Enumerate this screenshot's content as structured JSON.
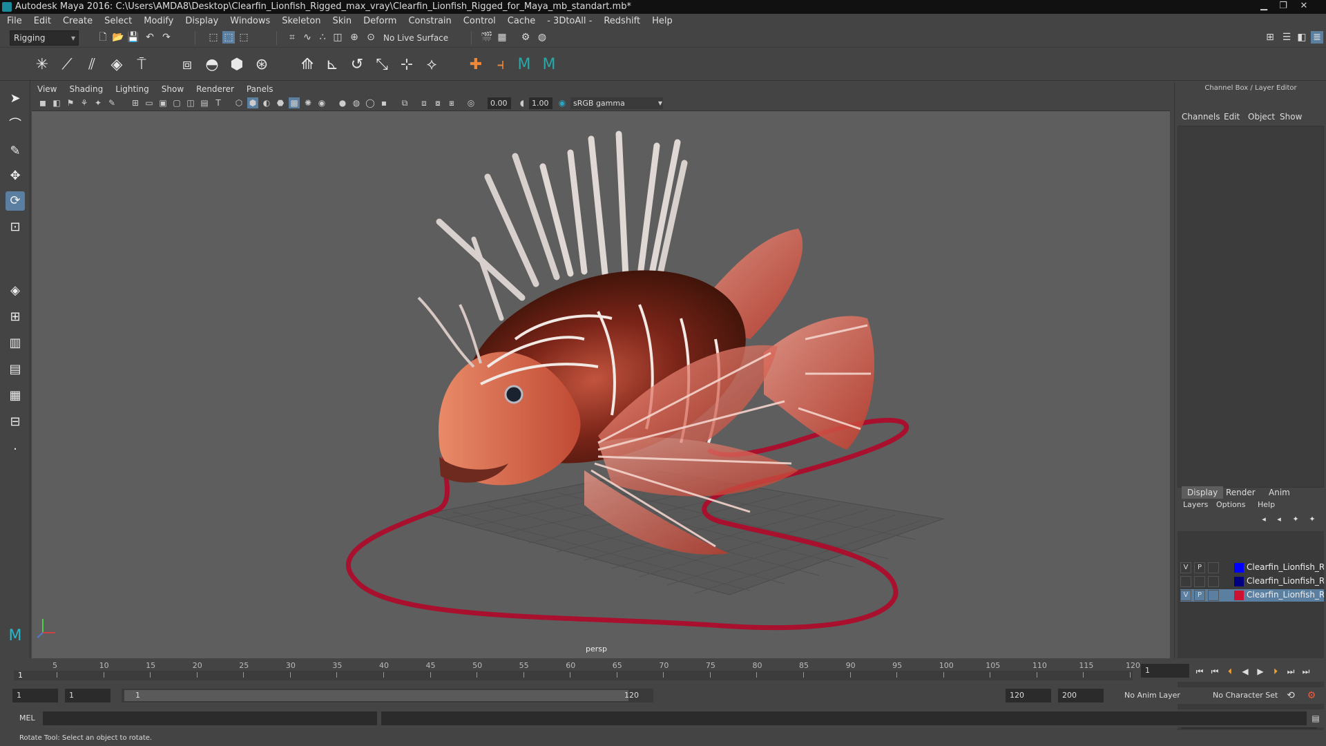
{
  "window": {
    "title": "Autodesk Maya 2016: C:\\Users\\AMDA8\\Desktop\\Clearfin_Lionfish_Rigged_max_vray\\Clearfin_Lionfish_Rigged_for_Maya_mb_standart.mb*"
  },
  "menu": [
    "File",
    "Edit",
    "Create",
    "Select",
    "Modify",
    "Display",
    "Windows",
    "Skeleton",
    "Skin",
    "Deform",
    "Constrain",
    "Control",
    "Cache",
    "- 3DtoAll -",
    "Redshift",
    "Help"
  ],
  "shelf": {
    "mode": "Rigging",
    "live_surface": "No Live Surface"
  },
  "viewport": {
    "menu": [
      "View",
      "Shading",
      "Lighting",
      "Show",
      "Renderer",
      "Panels"
    ],
    "exposure": "0.00",
    "gamma": "1.00",
    "color_space": "sRGB gamma",
    "camera_label": "persp"
  },
  "channel_box": {
    "title": "Channel Box / Layer Editor",
    "menu": [
      "Channels",
      "Edit",
      "Object",
      "Show"
    ]
  },
  "layer_editor": {
    "tabs": [
      "Display",
      "Render",
      "Anim"
    ],
    "menu": [
      "Layers",
      "Options",
      "Help"
    ],
    "layers": [
      {
        "v": "V",
        "p": "P",
        "color": "#0000ff",
        "name": "Clearfin_Lionfish_Rigg",
        "selected": false
      },
      {
        "v": "",
        "p": "",
        "color": "#000080",
        "name": "Clearfin_Lionfish_Rigg",
        "selected": false
      },
      {
        "v": "V",
        "p": "P",
        "color": "#cc1133",
        "name": "Clearfin_Lionfish_Rigg",
        "selected": true
      }
    ]
  },
  "timeline": {
    "ticks": [
      "5",
      "10",
      "15",
      "20",
      "25",
      "30",
      "35",
      "40",
      "45",
      "50",
      "55",
      "60",
      "65",
      "70",
      "75",
      "80",
      "85",
      "90",
      "95",
      "100",
      "105",
      "110",
      "115",
      "120"
    ],
    "current_frame": "1",
    "current_frame_field": "1"
  },
  "range": {
    "start": "1",
    "start_inner": "1",
    "slider_start": "1",
    "slider_end": "120",
    "end_inner": "120",
    "end": "200",
    "anim_layer": "No Anim Layer",
    "character_set": "No Character Set"
  },
  "command_line": {
    "label": "MEL"
  },
  "help_line": {
    "text": "Rotate Tool: Select an object to rotate."
  }
}
